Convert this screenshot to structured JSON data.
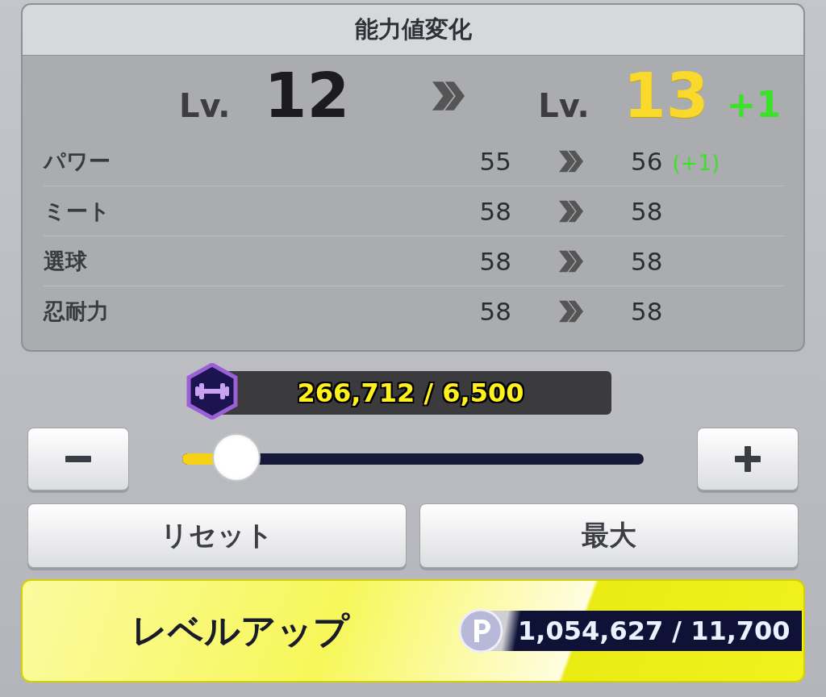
{
  "panel": {
    "title": "能力値変化",
    "level": {
      "before_label": "Lv.",
      "before": "12",
      "after_label": "Lv.",
      "after": "13",
      "gain": "+1"
    },
    "stats": [
      {
        "label": "パワー",
        "before": "55",
        "after": "56",
        "diff": "(+1)"
      },
      {
        "label": "ミート",
        "before": "58",
        "after": "58"
      },
      {
        "label": "選球",
        "before": "58",
        "after": "58"
      },
      {
        "label": "忍耐力",
        "before": "58",
        "after": "58"
      }
    ]
  },
  "material": {
    "amount": "266,712 / 6,500"
  },
  "slider": {
    "level": 0.12
  },
  "buttons": [
    {
      "label": "リセット"
    },
    {
      "label": "最大"
    }
  ],
  "level_up": {
    "label": "レベルアップ",
    "cost": "1,054,627 / 11,700"
  }
}
